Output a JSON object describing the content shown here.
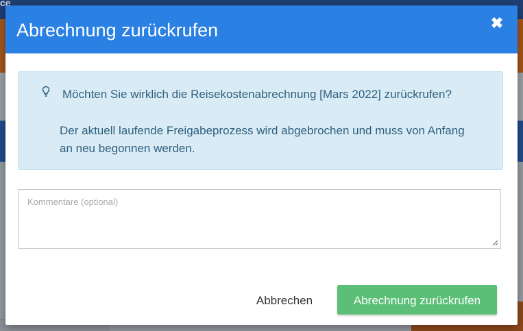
{
  "background": {
    "topbar_text": "ce"
  },
  "dialog": {
    "title": "Abrechnung zurückrufen",
    "close_icon": "close-icon",
    "info": {
      "icon": "lightbulb-icon",
      "question": "Möchten Sie wirklich die Reisekostenabrechnung [Mars 2022] zurückrufen?",
      "detail": "Der aktuell laufende Freigabeprozess wird abgebrochen und muss von Anfang an neu begonnen werden."
    },
    "comment": {
      "placeholder": "Kommentare (optional)",
      "value": ""
    },
    "buttons": {
      "cancel": "Abbrechen",
      "confirm": "Abrechnung zurückrufen"
    }
  },
  "colors": {
    "header": "#2b80e3",
    "info_bg": "#d9ecf6",
    "info_text": "#2f5f7e",
    "confirm": "#5cbf78"
  }
}
